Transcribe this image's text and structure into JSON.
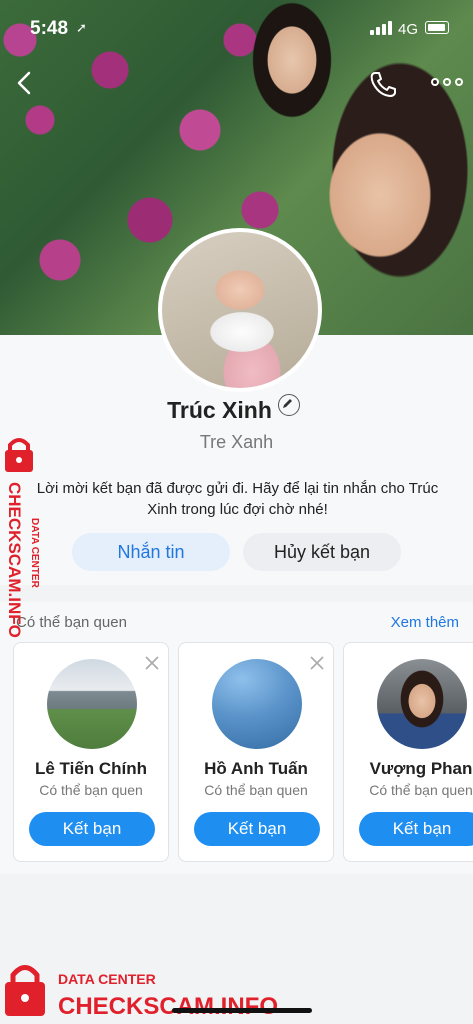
{
  "status_bar": {
    "time": "5:48",
    "network": "4G"
  },
  "profile": {
    "name": "Trúc Xinh",
    "alias": "Tre Xanh",
    "friend_request_message": "Lời mời kết bạn đã được gửi đi. Hãy để lại tin nhắn cho Trúc Xinh trong lúc đợi chờ nhé!",
    "message_button": "Nhắn tin",
    "cancel_button": "Hủy kết bạn"
  },
  "suggestions": {
    "title": "Có thể bạn quen",
    "see_more": "Xem thêm",
    "items": [
      {
        "name": "Lê Tiến Chính",
        "subtitle": "Có thể bạn quen",
        "button": "Kết bạn"
      },
      {
        "name": "Hồ Anh Tuấn",
        "subtitle": "Có thể bạn quen",
        "button": "Kết bạn"
      },
      {
        "name": "Vượng Phan",
        "subtitle": "Có thể bạn quen",
        "button": "Kết bạn"
      }
    ]
  },
  "watermark": {
    "line1": "DATA CENTER",
    "line2": "CHECKSCAM.INFO"
  },
  "colors": {
    "accent": "#1f8ef1",
    "link": "#1f77e0",
    "watermark": "#e0212b"
  }
}
